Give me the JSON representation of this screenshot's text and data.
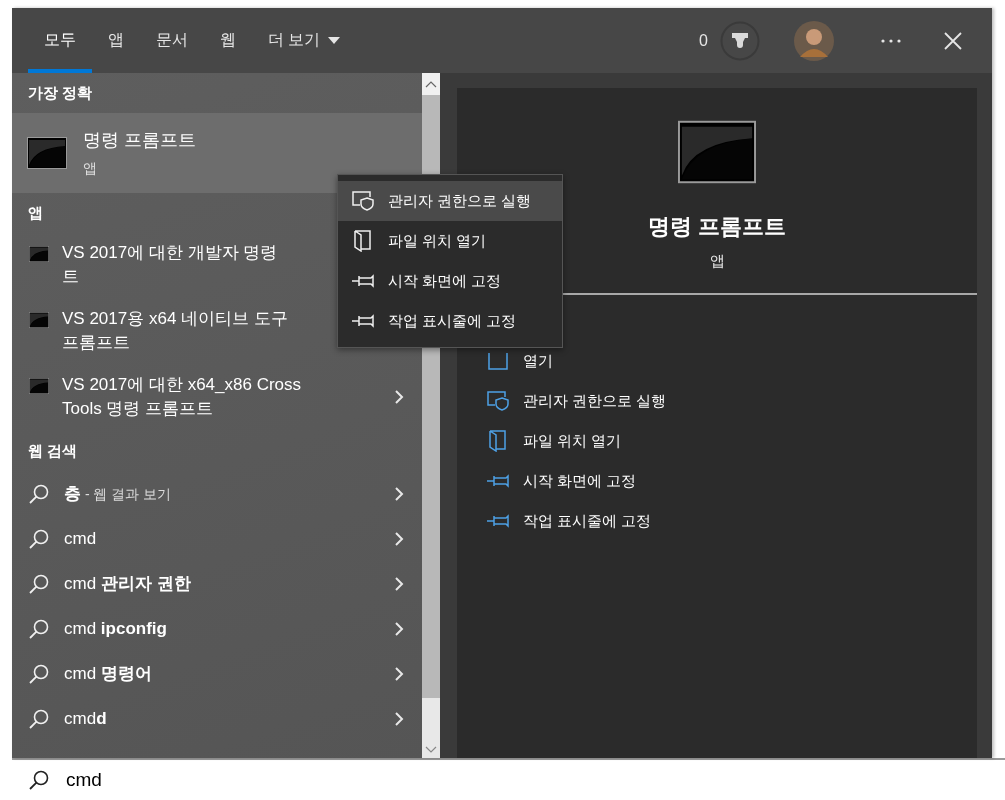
{
  "tabs": [
    {
      "label": "모두",
      "selected": true,
      "dropdown": false
    },
    {
      "label": "앱",
      "selected": false,
      "dropdown": false
    },
    {
      "label": "문서",
      "selected": false,
      "dropdown": false
    },
    {
      "label": "웹",
      "selected": false,
      "dropdown": false
    },
    {
      "label": "더 보기",
      "selected": false,
      "dropdown": true
    }
  ],
  "header": {
    "points": "0"
  },
  "best_match": {
    "heading": "가장 정확",
    "title": "명령 프롬프트",
    "subtitle": "앱",
    "selected": true
  },
  "apps": {
    "heading": "앱",
    "items": [
      {
        "lines": [
          "VS 2017에 대한 개발자 명령",
          "트"
        ]
      },
      {
        "lines": [
          "VS 2017용 x64 네이티브 도구",
          "프롬프트"
        ]
      },
      {
        "lines": [
          "VS 2017에 대한 x64_x86 Cross",
          "Tools 명령 프롬프트"
        ],
        "chevron": true
      }
    ]
  },
  "web_search": {
    "heading": "웹 검색",
    "items": [
      {
        "text": "**층**",
        "note": "- 웹 결과 보기"
      },
      {
        "text": "cmd"
      },
      {
        "text": "cmd **관리자 권한**"
      },
      {
        "text": "cmd **ipconfig**"
      },
      {
        "text": "cmd **명령어**"
      },
      {
        "text": "cmd**d**"
      }
    ]
  },
  "preview": {
    "title": "명령 프롬프트",
    "subtitle": "앱",
    "actions": [
      {
        "kind": "open",
        "label": "열기"
      },
      {
        "kind": "shield",
        "label": "관리자 권한으로 실행"
      },
      {
        "kind": "folder",
        "label": "파일 위치 열기"
      },
      {
        "kind": "pin",
        "label": "시작 화면에 고정"
      },
      {
        "kind": "pin",
        "label": "작업 표시줄에 고정"
      }
    ]
  },
  "context_menu": {
    "items": [
      {
        "kind": "shield",
        "label": "관리자 권한으로 실행",
        "selected": true
      },
      {
        "kind": "folder",
        "label": "파일 위치 열기",
        "selected": false
      },
      {
        "kind": "pin",
        "label": "시작 화면에 고정",
        "selected": false
      },
      {
        "kind": "pin",
        "label": "작업 표시줄에 고정",
        "selected": false
      }
    ]
  },
  "search_box": {
    "value": "cmd"
  }
}
